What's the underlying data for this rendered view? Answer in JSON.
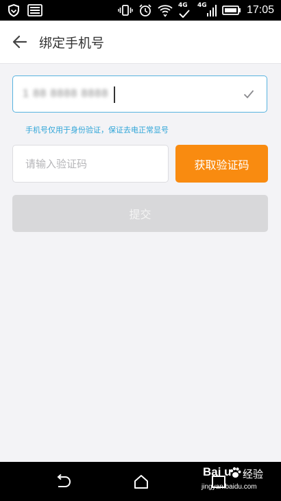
{
  "status_bar": {
    "time": "17:05",
    "network_top": "4G",
    "network_bottom": "4G"
  },
  "header": {
    "title": "绑定手机号"
  },
  "phone": {
    "value": "1 88 8888 8888"
  },
  "hint": "手机号仅用于身份验证，保证去电正常显号",
  "code": {
    "placeholder": "请输入验证码"
  },
  "get_code_label": "获取验证码",
  "submit_label": "提交",
  "watermark": {
    "brand": "Bai  u",
    "jingyan": "经验",
    "url": "jingyan.baidu.com"
  },
  "colors": {
    "accent_blue": "#56b2df",
    "hint_blue": "#2fa5d8",
    "orange": "#f98b10",
    "disabled_gray": "#d8d8da"
  }
}
